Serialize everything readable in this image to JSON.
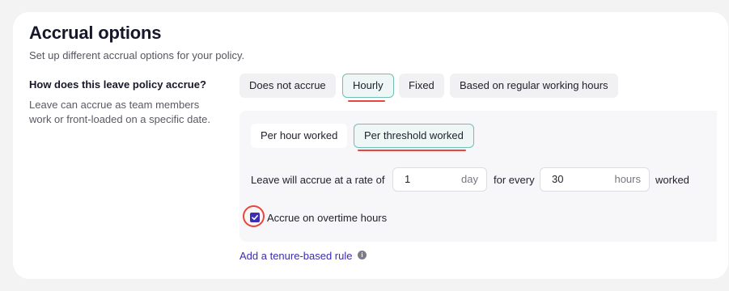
{
  "section": {
    "title": "Accrual options",
    "subtitle": "Set up different accrual options for your policy."
  },
  "question": {
    "title": "How does this leave policy accrue?",
    "description": "Leave can accrue as team members work or front-loaded on a specific date."
  },
  "accrual_types": [
    {
      "label": "Does not accrue",
      "selected": false
    },
    {
      "label": "Hourly",
      "selected": true
    },
    {
      "label": "Fixed",
      "selected": false
    },
    {
      "label": "Based on regular working hours",
      "selected": false
    }
  ],
  "hourly_modes": [
    {
      "label": "Per hour worked",
      "selected": false
    },
    {
      "label": "Per threshold worked",
      "selected": true
    }
  ],
  "rate": {
    "prefix": "Leave will accrue at a rate of",
    "amount_value": "1",
    "amount_unit": "day",
    "middle": "for every",
    "threshold_value": "30",
    "threshold_unit": "hours",
    "suffix": "worked"
  },
  "overtime": {
    "label": "Accrue on overtime hours",
    "checked": true
  },
  "tenure_link": "Add a tenure-based rule",
  "colors": {
    "accent": "#3d2db5",
    "selected_border": "#6fbfb4",
    "annotation_red": "#e8453c"
  }
}
